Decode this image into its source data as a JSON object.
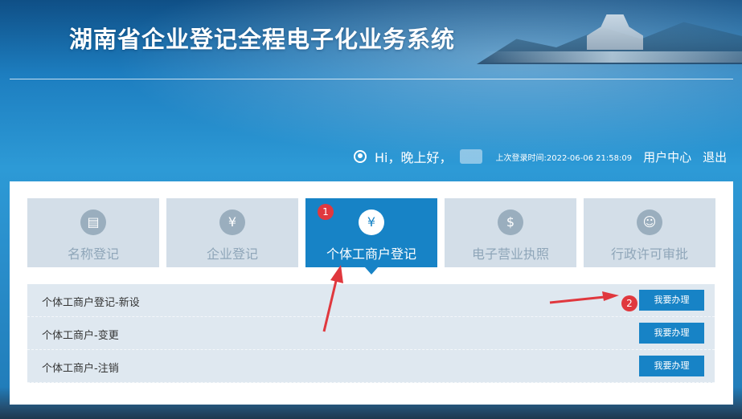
{
  "header": {
    "title": "湖南省企业登记全程电子化业务系统"
  },
  "userbar": {
    "greeting": "Hi，晚上好，",
    "last_login": "上次登录时间:2022-06-06 21:58:09",
    "user_center": "用户中心",
    "logout": "退出"
  },
  "tabs": [
    {
      "label": "名称登记",
      "icon": "document-icon",
      "glyph": "▤"
    },
    {
      "label": "企业登记",
      "icon": "enterprise-icon",
      "glyph": "¥"
    },
    {
      "label": "个体工商户登记",
      "icon": "business-license-icon",
      "glyph": "¥"
    },
    {
      "label": "电子营业执照",
      "icon": "money-icon",
      "glyph": "$"
    },
    {
      "label": "行政许可审批",
      "icon": "person-icon",
      "glyph": "☺"
    }
  ],
  "active_tab_index": 2,
  "annotations": [
    "1",
    "2"
  ],
  "services": [
    {
      "label": "个体工商户登记-新设",
      "button": "我要办理"
    },
    {
      "label": "个体工商户-变更",
      "button": "我要办理"
    },
    {
      "label": "个体工商户-注销",
      "button": "我要办理"
    }
  ],
  "colors": {
    "accent": "#1783c6",
    "tab_inactive": "#d3dee8",
    "row_bg": "#dfe8f0",
    "annotation_red": "#e0383e"
  }
}
